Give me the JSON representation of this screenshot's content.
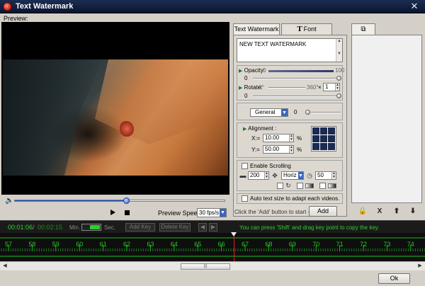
{
  "window": {
    "title": "Text Watermark",
    "close_glyph": "✕"
  },
  "preview": {
    "label": "Preview:",
    "seek_progress": 0.53,
    "speed_label": "Preview Speed:",
    "speed_value": "30 fps/s"
  },
  "tabs": {
    "watermark": "Text Watermark",
    "font": "Font",
    "list_icon": "layers-icon"
  },
  "watermark": {
    "text": "NEW TEXT WATERMARK",
    "opacity_label": "Opacity",
    "opacity_min": "0",
    "opacity_max": "100",
    "opacity_value": "0",
    "rotate_label": "Rotate",
    "rotate_min": "0°",
    "rotate_max": "360°",
    "rotate_times": "×",
    "rotate_multiplier": "1",
    "rotate_value": "0",
    "mode_value": "General",
    "mode_amount": "0",
    "alignment_label": "Alignment :",
    "x_label": "X:=",
    "x_value": "10.00",
    "y_label": "Y:=",
    "y_value": "50.00",
    "percent": "%",
    "scroll_label": "Enable Scrolling",
    "scroll_speed": "200",
    "scroll_dir": "Horiz",
    "scroll_interval": "50",
    "autosize_label": "Auto text size to adapt each videos."
  },
  "actions": {
    "add_hint": "Click the 'Add' button to start ->",
    "add_label": "Add",
    "ok_label": "Ok",
    "list_tools": [
      "🔒",
      "X",
      "⬆",
      "⬇"
    ]
  },
  "timeline": {
    "current_time": "00:01:06",
    "separator": "/",
    "total_time": "00:02:15",
    "min_label": "Min.",
    "sec_label": "Sec.",
    "add_key": "Add Key",
    "delete_key": "Delete Key",
    "hint": "You can press 'Shift' and drag key point to copy the key.",
    "ticks": [
      "57",
      "58",
      "59",
      "60",
      "61",
      "62",
      "63",
      "64",
      "65",
      "66",
      "67",
      "68",
      "69",
      "70",
      "71",
      "72",
      "73",
      "74"
    ]
  },
  "colors": {
    "timeline_green": "#1fd01f",
    "title_bar": "#0b1530",
    "accent_blue": "#3a66c0"
  }
}
